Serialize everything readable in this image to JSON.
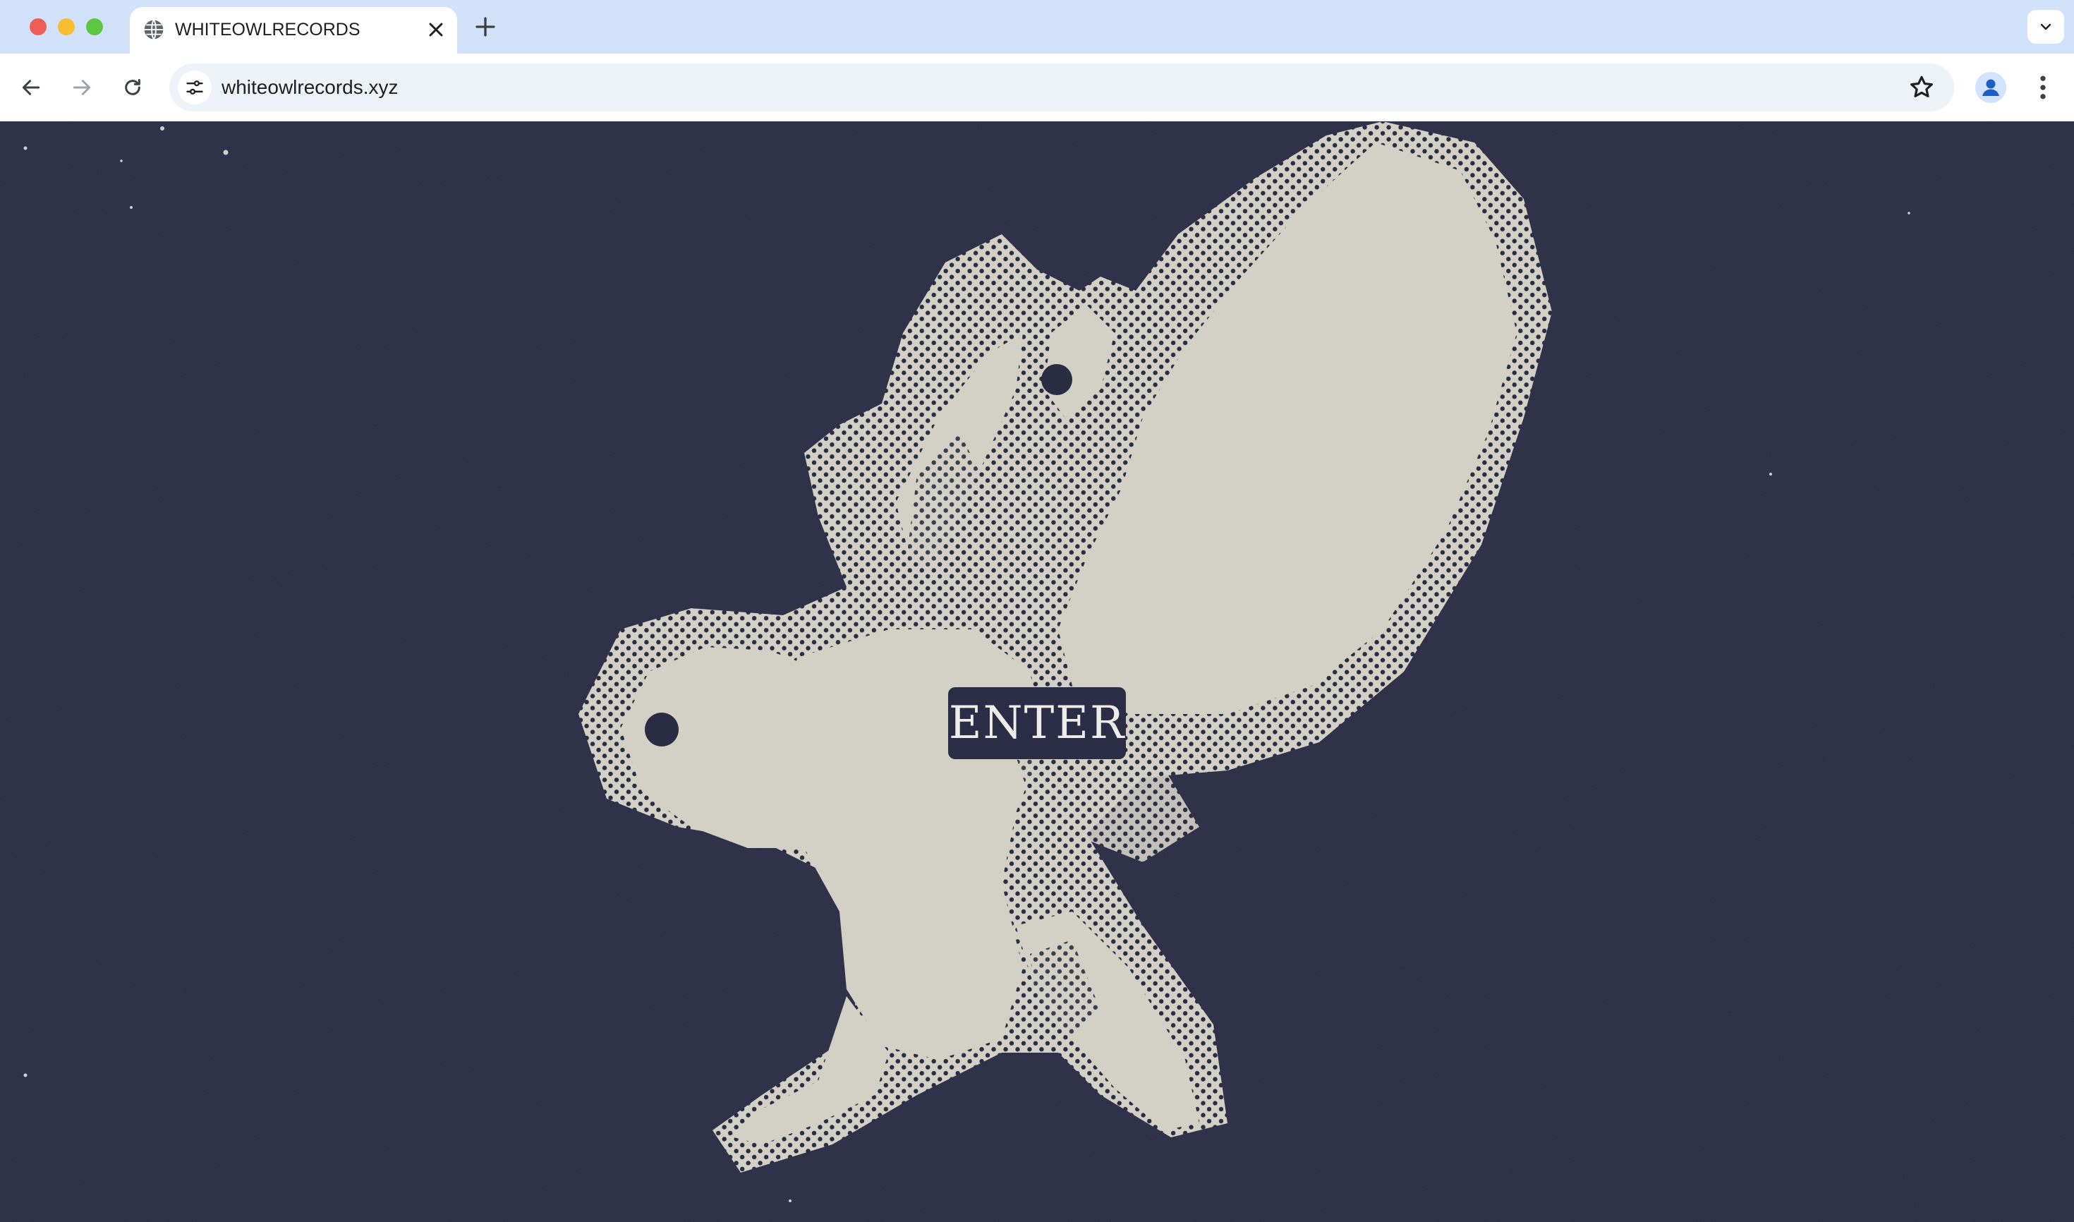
{
  "browser": {
    "tab": {
      "title": "WHITEOWLRECORDS",
      "favicon": "globe-icon",
      "close_icon": "close-icon"
    },
    "new_tab_icon": "plus-icon",
    "tab_search_icon": "chevron-down-icon",
    "toolbar": {
      "back_icon": "arrow-left-icon",
      "forward_icon": "arrow-right-icon",
      "reload_icon": "reload-icon",
      "site_info_icon": "tune-icon",
      "url": "whiteowlrecords.xyz",
      "bookmark_icon": "star-icon",
      "profile_icon": "person-icon",
      "menu_icon": "kebab-menu-icon"
    }
  },
  "page": {
    "background_color": "#2a2c44",
    "illustration": "halftone-white-owl",
    "illustration_color": "#d3d1c5",
    "enter_button": {
      "label": "ENTER"
    }
  }
}
